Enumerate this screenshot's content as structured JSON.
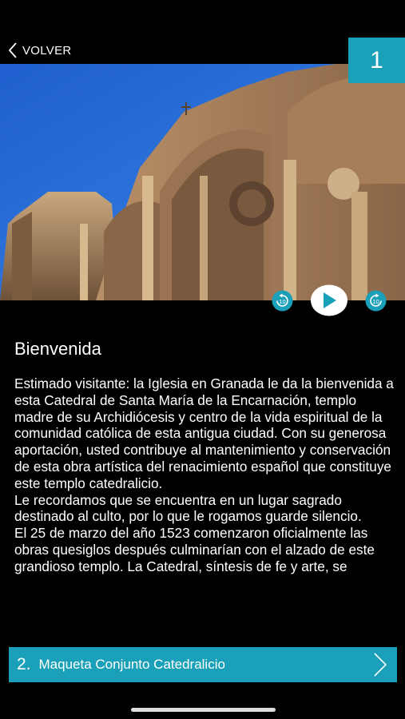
{
  "nav": {
    "back_label": "VOLVER",
    "track_number": "1"
  },
  "player": {
    "rewind_icon": "rewind-10-icon",
    "play_icon": "play-icon",
    "forward_icon": "forward-10-icon",
    "rewind_label": "10",
    "forward_label": "10"
  },
  "content": {
    "title": "Bienvenida",
    "paragraphs": [
      "Estimado visitante: la Iglesia en Granada le da la bienvenida a esta Catedral de Santa María de la Encarnación, templo madre de su Archidiócesis y centro de la vida espiritual de la comunidad católica de esta antigua ciudad. Con su generosa aportación, usted contribuye al mantenimiento y conservación de esta obra artística del renacimiento español que constituye este templo catedralicio.",
      "Le recordamos que se encuentra en un lugar sagrado destinado al culto, por lo que le rogamos guarde silencio.",
      "El 25 de marzo del año 1523 comenzaron oficialmente las obras quesiglos después culminarían con el alzado de este grandioso templo. La Catedral, síntesis de fe y arte, se"
    ]
  },
  "next": {
    "number": "2.",
    "label": "Maqueta Conjunto Catedralicio"
  },
  "colors": {
    "accent": "#1aa0b8",
    "background": "#000000",
    "text": "#ffffff"
  }
}
